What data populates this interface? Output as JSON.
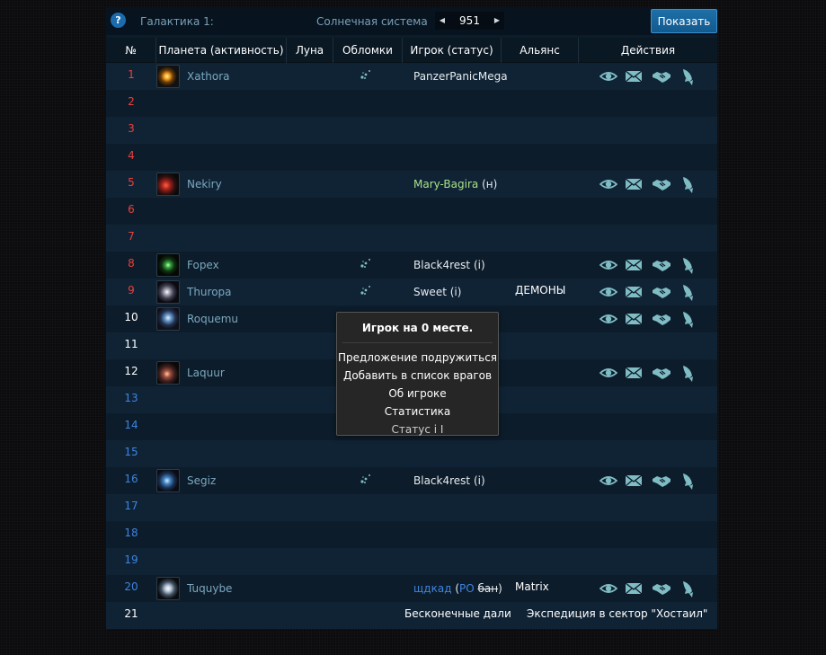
{
  "topbar": {
    "help_label": "?",
    "galaxy_label": "Галактика 1:",
    "system_label": "Солнечная система",
    "system_value": "951",
    "prev_label": "◀",
    "next_label": "▶",
    "show_button": "Показать"
  },
  "header": {
    "pos": "№",
    "planet": "Планета (активность)",
    "moon": "Луна",
    "debris": "Обломки",
    "player": "Игрок (статус)",
    "alliance": "Альянс",
    "actions": "Действия"
  },
  "rows": [
    {
      "pos": "1",
      "color": "red",
      "planet": "Xathora",
      "debris": true,
      "player": "PanzerPanicMega",
      "status": "",
      "alliance": "",
      "actions": true,
      "img": "sun"
    },
    {
      "pos": "2",
      "color": "red"
    },
    {
      "pos": "3",
      "color": "red"
    },
    {
      "pos": "4",
      "color": "red"
    },
    {
      "pos": "5",
      "color": "red",
      "planet": "Nekiry",
      "debris": false,
      "player": "Mary-Bagira",
      "player_class": "green",
      "status": "(н)",
      "alliance": "",
      "actions": true,
      "img": "red"
    },
    {
      "pos": "6",
      "color": "red"
    },
    {
      "pos": "7",
      "color": "red"
    },
    {
      "pos": "8",
      "color": "red",
      "planet": "Fopex",
      "debris": true,
      "player": "Black4rest",
      "status": "(i)",
      "alliance": "",
      "actions": true,
      "img": "green"
    },
    {
      "pos": "9",
      "color": "red",
      "planet": "Thuropa",
      "debris": true,
      "player": "Sweet",
      "status": "(i)",
      "alliance": "ДЕМОНЫ",
      "actions": true,
      "img": "grey"
    },
    {
      "pos": "10",
      "color": "white",
      "planet": "Roquemu",
      "debris": false,
      "player": "",
      "status": "",
      "alliance": "",
      "actions": true,
      "img": "blue"
    },
    {
      "pos": "11",
      "color": "white"
    },
    {
      "pos": "12",
      "color": "white",
      "planet": "Laquur",
      "debris": false,
      "player": "",
      "status": "",
      "alliance": "",
      "actions": true,
      "img": "rock"
    },
    {
      "pos": "13",
      "color": "blue"
    },
    {
      "pos": "14",
      "color": "blue"
    },
    {
      "pos": "15",
      "color": "blue"
    },
    {
      "pos": "16",
      "color": "blue",
      "planet": "Segiz",
      "debris": true,
      "player": "Black4rest",
      "status": "(i)",
      "alliance": "",
      "actions": true,
      "img": "cyan"
    },
    {
      "pos": "17",
      "color": "blue"
    },
    {
      "pos": "18",
      "color": "blue"
    },
    {
      "pos": "19",
      "color": "blue"
    },
    {
      "pos": "20",
      "color": "blue",
      "planet": "Tuquybe",
      "debris": false,
      "player": "щдкад",
      "player_class": "blue",
      "status_parts": [
        "(",
        "PO",
        " ",
        "бан",
        ")"
      ],
      "alliance": "Matrix",
      "actions": true,
      "img": "white"
    },
    {
      "pos": "21",
      "color": "white",
      "special_a": "Бесконечные дали",
      "special_b": "Экспедиция в сектор \"Хостаил\""
    }
  ],
  "popup": {
    "title": "Игрок на 0 месте.",
    "items": [
      "Предложение подружиться",
      "Добавить в список врагов",
      "Об игроке",
      "Статистика"
    ],
    "status": "Статус i I"
  },
  "colors": {
    "red": "#e8413c",
    "blue": "#3c84e0",
    "green": "#a9e08a",
    "icon": "#7fbcc4",
    "accent": "#1e6fa8"
  }
}
